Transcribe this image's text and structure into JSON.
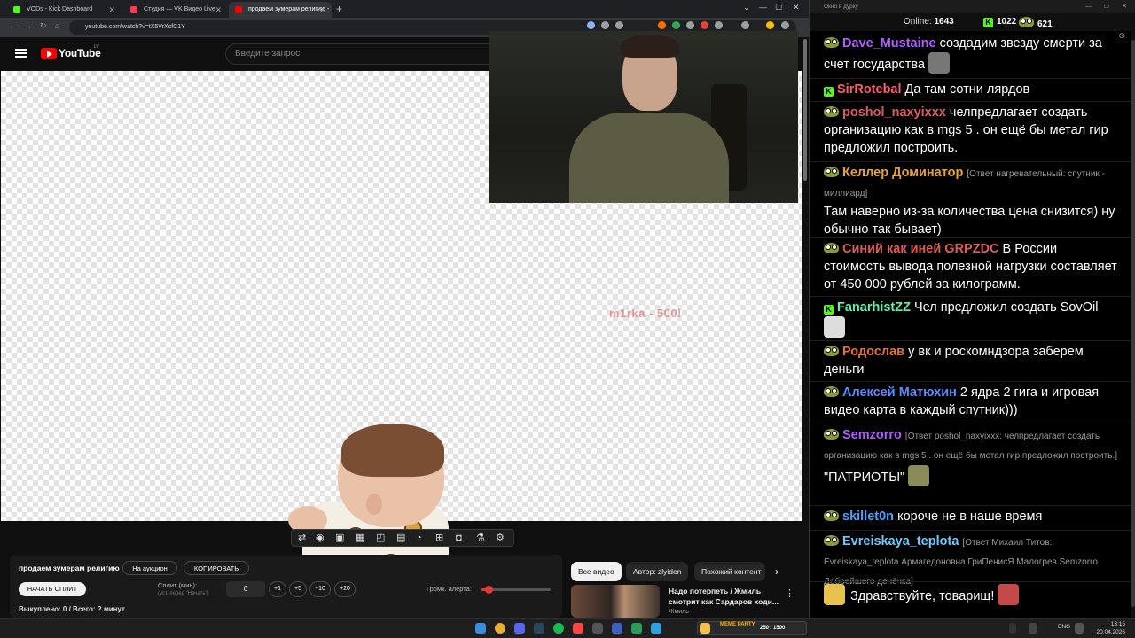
{
  "browser": {
    "tabs": [
      {
        "label": "VODs - Kick Dashboard",
        "color": "#53fc18",
        "active": false
      },
      {
        "label": "Студия — VK Видео Live",
        "color": "#ff3b5c",
        "active": false
      },
      {
        "label": "продаем зумерам религию - ",
        "color": "#ff0000",
        "active": true
      }
    ],
    "url": "youtube.com/watch?v=tX5VrXcfC1Y"
  },
  "youtube": {
    "brand": "YouTube",
    "region": "LV",
    "search_placeholder": "Введите запрос"
  },
  "video": {
    "overlay_text": "m1rka - 500!"
  },
  "panel": {
    "stream_title": "продаем зумерам религию",
    "auction_label": "На аукцион",
    "copy_label": "КОПИРОВАТЬ",
    "start_split_label": "НАЧАТЬ СПЛИТ",
    "split_label": "Сплит (мин):",
    "split_hint": "(уст. перед \"Начать\")",
    "split_value": "0",
    "steps": [
      "+1",
      "+5",
      "+10",
      "+20"
    ],
    "volume_label": "Громк. алерта:",
    "volume_level": 0.1,
    "sold_text": "Выкуплено: 0 / Всего: ? минут"
  },
  "recommendations": {
    "chips": [
      "Все видео",
      "Автор: zlyiden",
      "Похожий контент"
    ],
    "item": {
      "title": "Надо потерпеть / Жмиль смотрит как Сардаров ходи...",
      "channel": "Жмиль"
    }
  },
  "chat_window": {
    "title": "Окно в дурку",
    "online_label": "Online:",
    "online_count": "1643",
    "kick_count": "1022",
    "other_count": "621",
    "messages": [
      {
        "badge": "frog",
        "nick": "Dave_Mustaine",
        "color": "#b05cff",
        "reply": "",
        "text": "создадим звезду смерти за счет государства",
        "emote": "#777777"
      },
      {
        "badge": "kick",
        "nick": "SirRotebal",
        "color": "#ff5c6c",
        "reply": "",
        "text": "Да там сотни лярдов",
        "emote": ""
      },
      {
        "badge": "frog",
        "nick": "poshol_naxyixxx",
        "color": "#e05a5a",
        "reply": "",
        "text": "челпредлагает создать организацию как в mgs 5 . он ещё бы метал гир предложил построить.",
        "emote": ""
      },
      {
        "badge": "frog",
        "nick": "Келлер Доминатор",
        "color": "#e8a23a",
        "reply": "[Ответ нагревательный: спутник - миллиард]",
        "text": "Там наверно из-за количества цена снизится) ну обычно так бывает)",
        "emote": ""
      },
      {
        "badge": "frog",
        "nick": "Синий как иней GRPZDC",
        "color": "#e05a5a",
        "reply": "",
        "text": "В России стоимость вывода полезной нагрузки составляет от 450 000 рублей за килограмм.",
        "emote": ""
      },
      {
        "badge": "kick",
        "nick": "FanarhistZZ",
        "color": "#5ef3a8",
        "reply": "",
        "text": "Чел предложил создать SovOil",
        "emote": "#dddddd"
      },
      {
        "badge": "frog",
        "nick": "Родослав",
        "color": "#e8703a",
        "reply": "",
        "text": "у вк и роскомндзора заберем деньги",
        "emote": ""
      },
      {
        "badge": "frog",
        "nick": "Алексей Матюхин",
        "color": "#5a8cff",
        "reply": "",
        "text": "2 ядра 2 гига и игровая видео карта в каждый спутник)))",
        "emote": ""
      },
      {
        "badge": "frog",
        "nick": "Semzorro",
        "color": "#b05cff",
        "reply": "[Ответ poshol_naxyixxx: челпредлагает создать организацию как в mgs 5 . он ещё бы метал гир предложил построить.]",
        "text": "\"ПАТРИОТЫ\"",
        "emote": "#8a8a5a"
      },
      {
        "badge": "frog",
        "nick": "skillet0n",
        "color": "#4aa3ff",
        "reply": "",
        "text": "короче не в наше время",
        "emote": ""
      },
      {
        "badge": "frog",
        "nick": "Evreiskaya_teplota",
        "color": "#6ecbff",
        "reply": "[Ответ Михаил Титов: Evreiskaya_teplota Армагедоновна ГриПенисЯ Малогрев Semzorro Добрейшего денёчка]",
        "text": "",
        "emote": ""
      },
      {
        "badge": "emote",
        "nick": "",
        "color": "#ffffff",
        "reply": "",
        "text": "Здравствуйте, товарищ!",
        "emote": "#c44a4a"
      }
    ]
  },
  "taskbar": {
    "app_name": "MEME PARTY",
    "app_counter": "250 / 1500",
    "lang": "ENG",
    "time": "13:15",
    "date": "20.04.2026"
  }
}
